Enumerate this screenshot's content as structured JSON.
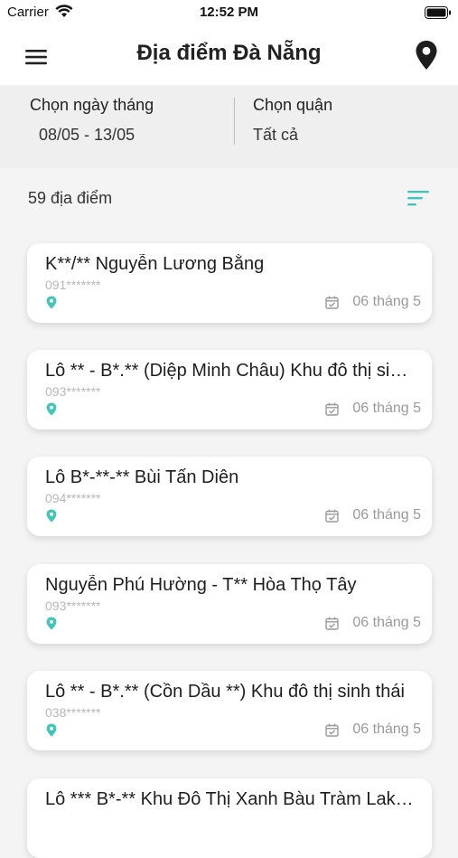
{
  "status_bar": {
    "carrier": "Carrier",
    "time": "12:52 PM"
  },
  "nav": {
    "title": "Địa điểm Đà Nẵng"
  },
  "filters": {
    "date_label": "Chọn ngày tháng",
    "date_value": "08/05 - 13/05",
    "district_label": "Chọn quận",
    "district_value": "Tất cả"
  },
  "list": {
    "count": "59 địa điểm",
    "items": [
      {
        "title": "K**/** Nguyễn Lương Bằng",
        "phone": "091*******",
        "date": "06 tháng 5"
      },
      {
        "title": "Lô ** - B*.** (Diệp Minh Châu) Khu đô thị sinh thái",
        "phone": "093*******",
        "date": "06 tháng 5"
      },
      {
        "title": "Lô B*-**-** Bùi Tấn Diên",
        "phone": "094*******",
        "date": "06 tháng 5"
      },
      {
        "title": "Nguyễn Phú Hường - T** Hòa Thọ Tây",
        "phone": "093*******",
        "date": "06 tháng 5"
      },
      {
        "title": "Lô ** - B*.** (Cồn Dầu **) Khu đô thị sinh thái",
        "phone": "038*******",
        "date": "06 tháng 5"
      },
      {
        "title": "Lô *** B*-** Khu Đô Thị Xanh Bàu Tràm Lakeside",
        "phone": "",
        "date": ""
      }
    ]
  },
  "colors": {
    "accent": "#3ec7b8",
    "nav_bg": "#ffffff",
    "panel_bg": "#efefef"
  },
  "icons": {
    "menu": "menu-icon",
    "location": "location-pin-icon",
    "sort": "sort-icon",
    "card_pin": "pin-icon",
    "calendar": "calendar-icon"
  }
}
